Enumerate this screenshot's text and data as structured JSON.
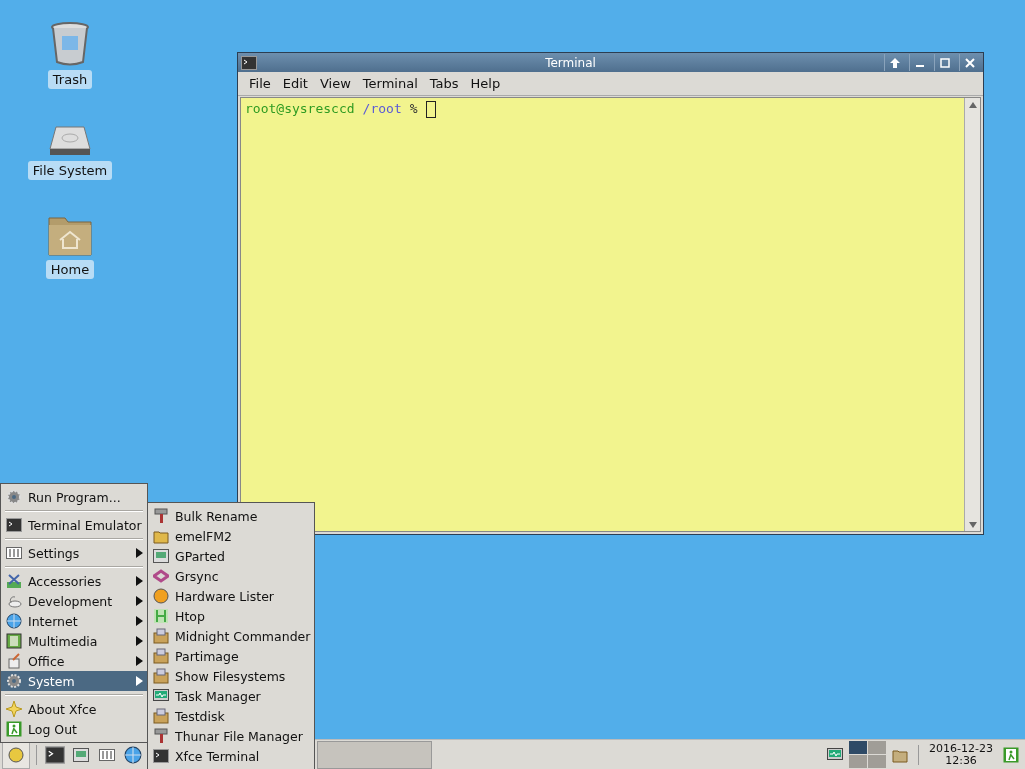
{
  "desktop_icons": [
    {
      "label": "Trash"
    },
    {
      "label": "File System"
    },
    {
      "label": "Home"
    }
  ],
  "terminal": {
    "title": "Terminal",
    "menu": [
      "File",
      "Edit",
      "View",
      "Terminal",
      "Tabs",
      "Help"
    ],
    "prompt_user": "root@sysresccd",
    "prompt_path": "/root",
    "prompt_sign": "%"
  },
  "main_menu": [
    {
      "kind": "item",
      "label": "Run Program...",
      "submenu": false,
      "selected": false
    },
    {
      "kind": "separator"
    },
    {
      "kind": "item",
      "label": "Terminal Emulator",
      "submenu": false,
      "selected": false
    },
    {
      "kind": "separator"
    },
    {
      "kind": "item",
      "label": "Settings",
      "submenu": true,
      "selected": false
    },
    {
      "kind": "separator"
    },
    {
      "kind": "item",
      "label": "Accessories",
      "submenu": true,
      "selected": false
    },
    {
      "kind": "item",
      "label": "Development",
      "submenu": true,
      "selected": false
    },
    {
      "kind": "item",
      "label": "Internet",
      "submenu": true,
      "selected": false
    },
    {
      "kind": "item",
      "label": "Multimedia",
      "submenu": true,
      "selected": false
    },
    {
      "kind": "item",
      "label": "Office",
      "submenu": true,
      "selected": false
    },
    {
      "kind": "item",
      "label": "System",
      "submenu": true,
      "selected": true
    },
    {
      "kind": "separator"
    },
    {
      "kind": "item",
      "label": "About Xfce",
      "submenu": false,
      "selected": false
    },
    {
      "kind": "item",
      "label": "Log Out",
      "submenu": false,
      "selected": false
    }
  ],
  "system_submenu": [
    {
      "label": "Bulk Rename"
    },
    {
      "label": "emelFM2"
    },
    {
      "label": "GParted"
    },
    {
      "label": "Grsync"
    },
    {
      "label": "Hardware Lister"
    },
    {
      "label": "Htop"
    },
    {
      "label": "Midnight Commander"
    },
    {
      "label": "Partimage"
    },
    {
      "label": "Show Filesystems"
    },
    {
      "label": "Task Manager"
    },
    {
      "label": "Testdisk"
    },
    {
      "label": "Thunar File Manager"
    },
    {
      "label": "Xfce Terminal"
    }
  ],
  "taskbar": {
    "workspaces": [
      {
        "selected": true
      },
      {
        "selected": false
      },
      {
        "selected": false
      },
      {
        "selected": false
      }
    ],
    "clock_date": "2016-12-23",
    "clock_time": "12:36"
  }
}
